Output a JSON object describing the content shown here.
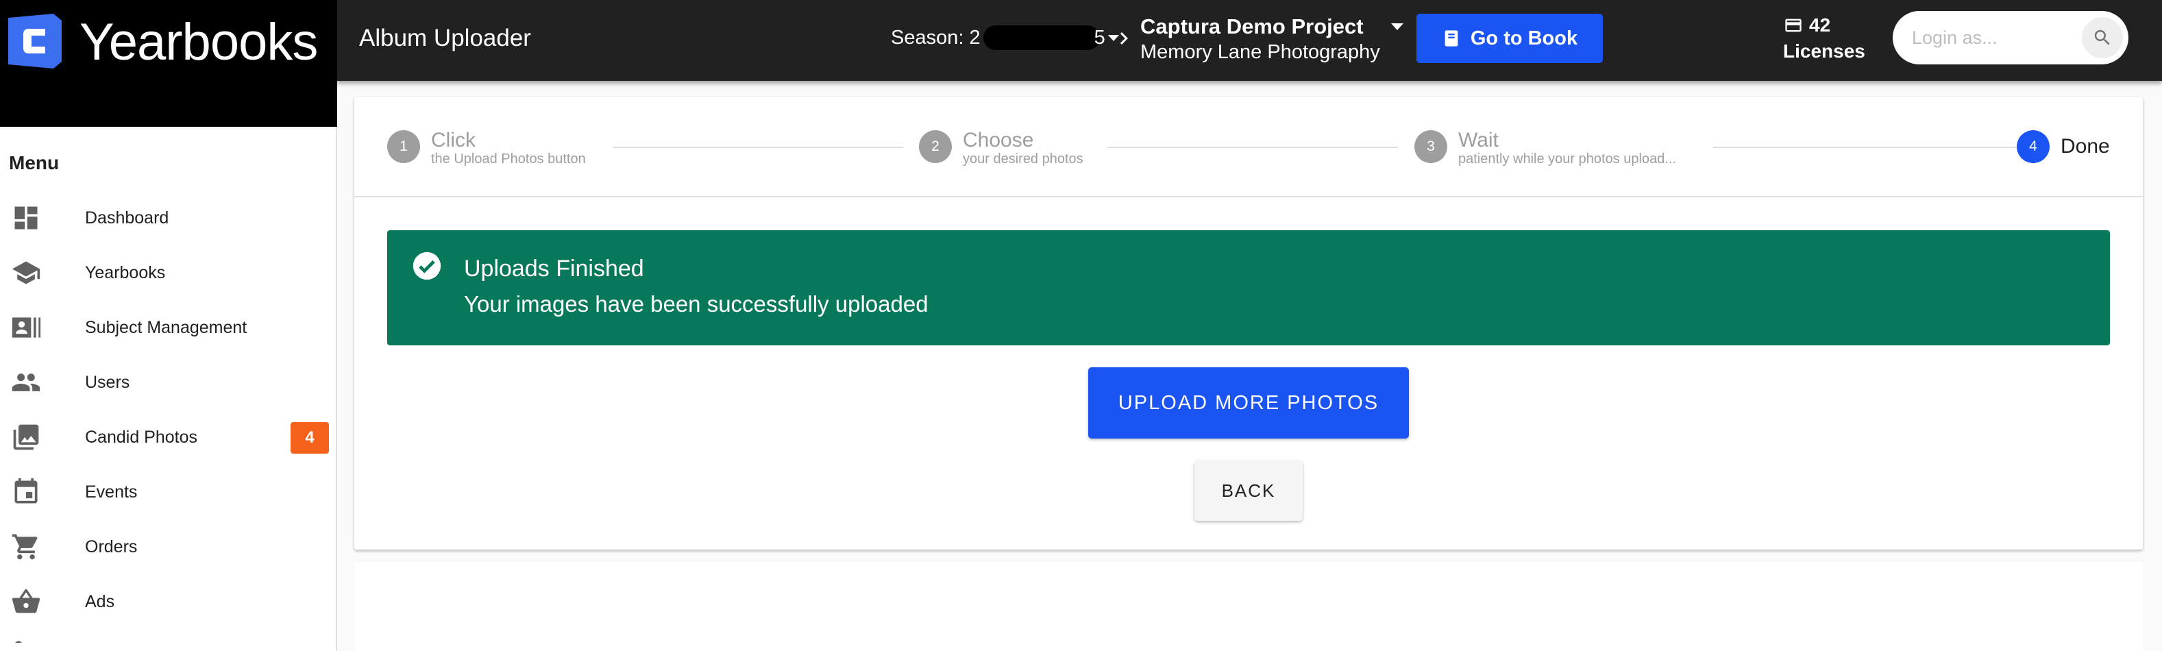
{
  "brand": {
    "name": "Yearbooks"
  },
  "sidebar": {
    "menu_title": "Menu",
    "items": [
      {
        "label": "Dashboard",
        "icon": "dashboard-icon"
      },
      {
        "label": "Yearbooks",
        "icon": "school-icon"
      },
      {
        "label": "Subject Management",
        "icon": "contact-card-icon"
      },
      {
        "label": "Users",
        "icon": "people-icon"
      },
      {
        "label": "Candid Photos",
        "icon": "photo-library-icon",
        "badge": "4"
      },
      {
        "label": "Events",
        "icon": "calendar-icon"
      },
      {
        "label": "Orders",
        "icon": "cart-icon"
      },
      {
        "label": "Ads",
        "icon": "basket-icon"
      }
    ]
  },
  "header": {
    "title": "Album Uploader",
    "season_label": "Season: 2",
    "season_suffix": "5",
    "project_name": "Captura Demo Project",
    "project_company": "Memory Lane Photography",
    "goto_label": "Go to Book",
    "licenses_count": "42",
    "licenses_label": "Licenses",
    "login_placeholder": "Login as..."
  },
  "stepper": {
    "steps": [
      {
        "number": "1",
        "title": "Click",
        "subtitle": "the Upload Photos button"
      },
      {
        "number": "2",
        "title": "Choose",
        "subtitle": "your desired photos"
      },
      {
        "number": "3",
        "title": "Wait",
        "subtitle": "patiently while your photos upload..."
      },
      {
        "number": "4",
        "title": "Done",
        "subtitle": ""
      }
    ]
  },
  "alert": {
    "title": "Uploads Finished",
    "message": "Your images have been successfully uploaded"
  },
  "actions": {
    "upload_more": "UPLOAD MORE PHOTOS",
    "back": "BACK"
  },
  "colors": {
    "header_bg": "#212121",
    "primary": "#1a55f3",
    "success": "#07795a",
    "badge": "#f4611a"
  }
}
